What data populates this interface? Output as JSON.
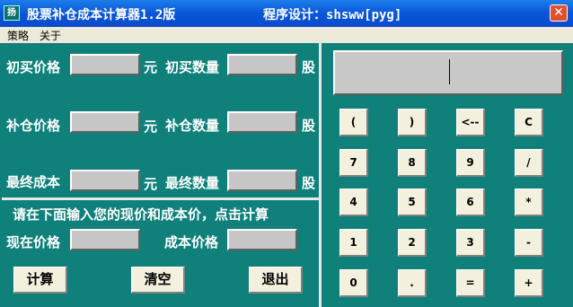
{
  "window": {
    "title": "股票补仓成本计算器1.2版",
    "author": "程序设计：shsww[pyg]",
    "close_symbol": "✕",
    "icon_text": "扬"
  },
  "menu": {
    "items": [
      "策略",
      "关于"
    ]
  },
  "form": {
    "initial_price_label": "初买价格",
    "initial_qty_label": "初买数量",
    "add_price_label": "补仓价格",
    "add_qty_label": "补仓数量",
    "final_cost_label": "最终成本",
    "final_qty_label": "最终数量",
    "currency_unit": "元",
    "share_unit": "股",
    "instruction": "请在下面输入您的现价和成本价，点击计算",
    "current_price_label": "现在价格",
    "cost_price_label": "成本价格",
    "calc_button": "计算",
    "clear_button": "清空",
    "exit_button": "退出"
  },
  "calculator": {
    "display_value": "",
    "keys": [
      [
        "(",
        ")",
        "<--",
        "C"
      ],
      [
        "7",
        "8",
        "9",
        "/"
      ],
      [
        "4",
        "5",
        "6",
        "*"
      ],
      [
        "1",
        "2",
        "3",
        "-"
      ],
      [
        "0",
        ".",
        "=",
        "+"
      ]
    ]
  }
}
